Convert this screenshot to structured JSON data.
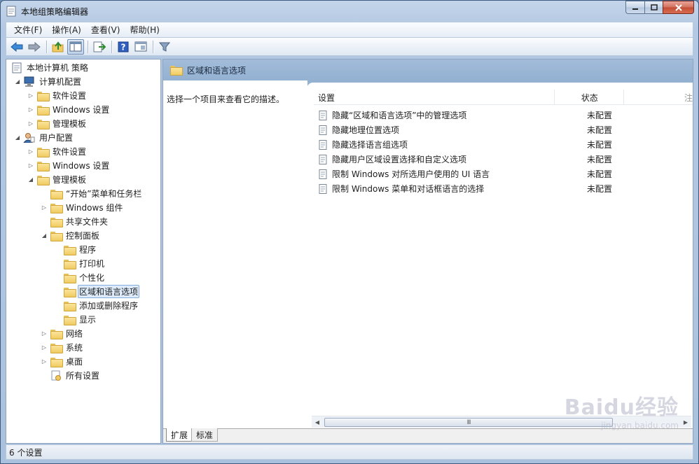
{
  "window": {
    "title": "本地组策略编辑器"
  },
  "menu": [
    "文件(F)",
    "操作(A)",
    "查看(V)",
    "帮助(H)"
  ],
  "tree": [
    {
      "label": "本地计算机 策略",
      "level": 0,
      "arrow": "",
      "icon": "policy-icon"
    },
    {
      "label": "计算机配置",
      "level": 1,
      "arrow": "open",
      "icon": "computer-icon"
    },
    {
      "label": "软件设置",
      "level": 2,
      "arrow": "closed",
      "icon": "folder-icon"
    },
    {
      "label": "Windows 设置",
      "level": 2,
      "arrow": "closed",
      "icon": "folder-icon"
    },
    {
      "label": "管理模板",
      "level": 2,
      "arrow": "closed",
      "icon": "folder-icon"
    },
    {
      "label": "用户配置",
      "level": 1,
      "arrow": "open",
      "icon": "user-icon"
    },
    {
      "label": "软件设置",
      "level": 2,
      "arrow": "closed",
      "icon": "folder-icon"
    },
    {
      "label": "Windows 设置",
      "level": 2,
      "arrow": "closed",
      "icon": "folder-icon"
    },
    {
      "label": "管理模板",
      "level": 2,
      "arrow": "open",
      "icon": "folder-icon"
    },
    {
      "label": "“开始”菜单和任务栏",
      "level": 3,
      "arrow": "",
      "icon": "folder-icon"
    },
    {
      "label": "Windows 组件",
      "level": 3,
      "arrow": "closed",
      "icon": "folder-icon"
    },
    {
      "label": "共享文件夹",
      "level": 3,
      "arrow": "",
      "icon": "folder-icon"
    },
    {
      "label": "控制面板",
      "level": 3,
      "arrow": "open",
      "icon": "folder-icon"
    },
    {
      "label": "程序",
      "level": 4,
      "arrow": "",
      "icon": "folder-icon"
    },
    {
      "label": "打印机",
      "level": 4,
      "arrow": "",
      "icon": "folder-icon"
    },
    {
      "label": "个性化",
      "level": 4,
      "arrow": "",
      "icon": "folder-icon"
    },
    {
      "label": "区域和语言选项",
      "level": 4,
      "arrow": "",
      "icon": "folder-icon",
      "selected": true
    },
    {
      "label": "添加或删除程序",
      "level": 4,
      "arrow": "",
      "icon": "folder-icon"
    },
    {
      "label": "显示",
      "level": 4,
      "arrow": "",
      "icon": "folder-icon"
    },
    {
      "label": "网络",
      "level": 3,
      "arrow": "closed",
      "icon": "folder-icon"
    },
    {
      "label": "系统",
      "level": 3,
      "arrow": "closed",
      "icon": "folder-icon"
    },
    {
      "label": "桌面",
      "level": 3,
      "arrow": "closed",
      "icon": "folder-icon"
    },
    {
      "label": "所有设置",
      "level": 3,
      "arrow": "",
      "icon": "all-settings-icon"
    }
  ],
  "right": {
    "header_title": "区域和语言选项",
    "description": "选择一个项目来查看它的描述。",
    "columns": [
      "设置",
      "状态",
      "注"
    ],
    "rows": [
      {
        "name": "隐藏“区域和语言选项”中的管理选项",
        "state": "未配置"
      },
      {
        "name": "隐藏地理位置选项",
        "state": "未配置"
      },
      {
        "name": "隐藏选择语言组选项",
        "state": "未配置"
      },
      {
        "name": "隐藏用户区域设置选择和自定义选项",
        "state": "未配置"
      },
      {
        "name": "限制 Windows 对所选用户使用的 UI 语言",
        "state": "未配置"
      },
      {
        "name": "限制 Windows 菜单和对话框语言的选择",
        "state": "未配置"
      }
    ],
    "tabs": [
      "扩展",
      "标准"
    ],
    "scroll_thumb": "III"
  },
  "status": "6 个设置",
  "watermark": {
    "brand": "Baidu经验",
    "url": "jingyan.baidu.com"
  }
}
